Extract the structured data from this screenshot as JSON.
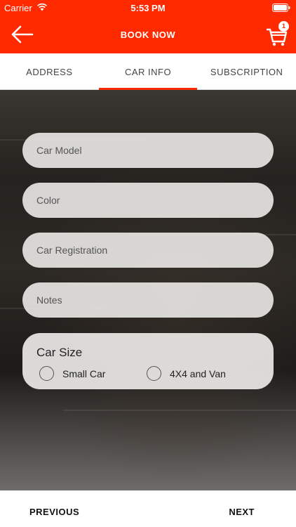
{
  "status_bar": {
    "carrier": "Carrier",
    "time": "5:53 PM"
  },
  "nav": {
    "title": "BOOK NOW",
    "back_icon": "back-arrow-icon",
    "cart_icon": "cart-icon",
    "cart_count": "1"
  },
  "tabs": [
    {
      "label": "ADDRESS",
      "active": false
    },
    {
      "label": "CAR INFO",
      "active": true
    },
    {
      "label": "SUBSCRIPTION",
      "active": false
    }
  ],
  "form": {
    "car_model_placeholder": "Car Model",
    "color_placeholder": "Color",
    "registration_placeholder": "Car Registration",
    "notes_placeholder": "Notes",
    "car_size": {
      "title": "Car Size",
      "options": [
        {
          "label": "Small Car",
          "selected": false
        },
        {
          "label": "4X4 and Van",
          "selected": false
        }
      ]
    }
  },
  "footer": {
    "previous_label": "PREVIOUS",
    "next_label": "NEXT"
  },
  "colors": {
    "accent": "#ff2a00"
  }
}
